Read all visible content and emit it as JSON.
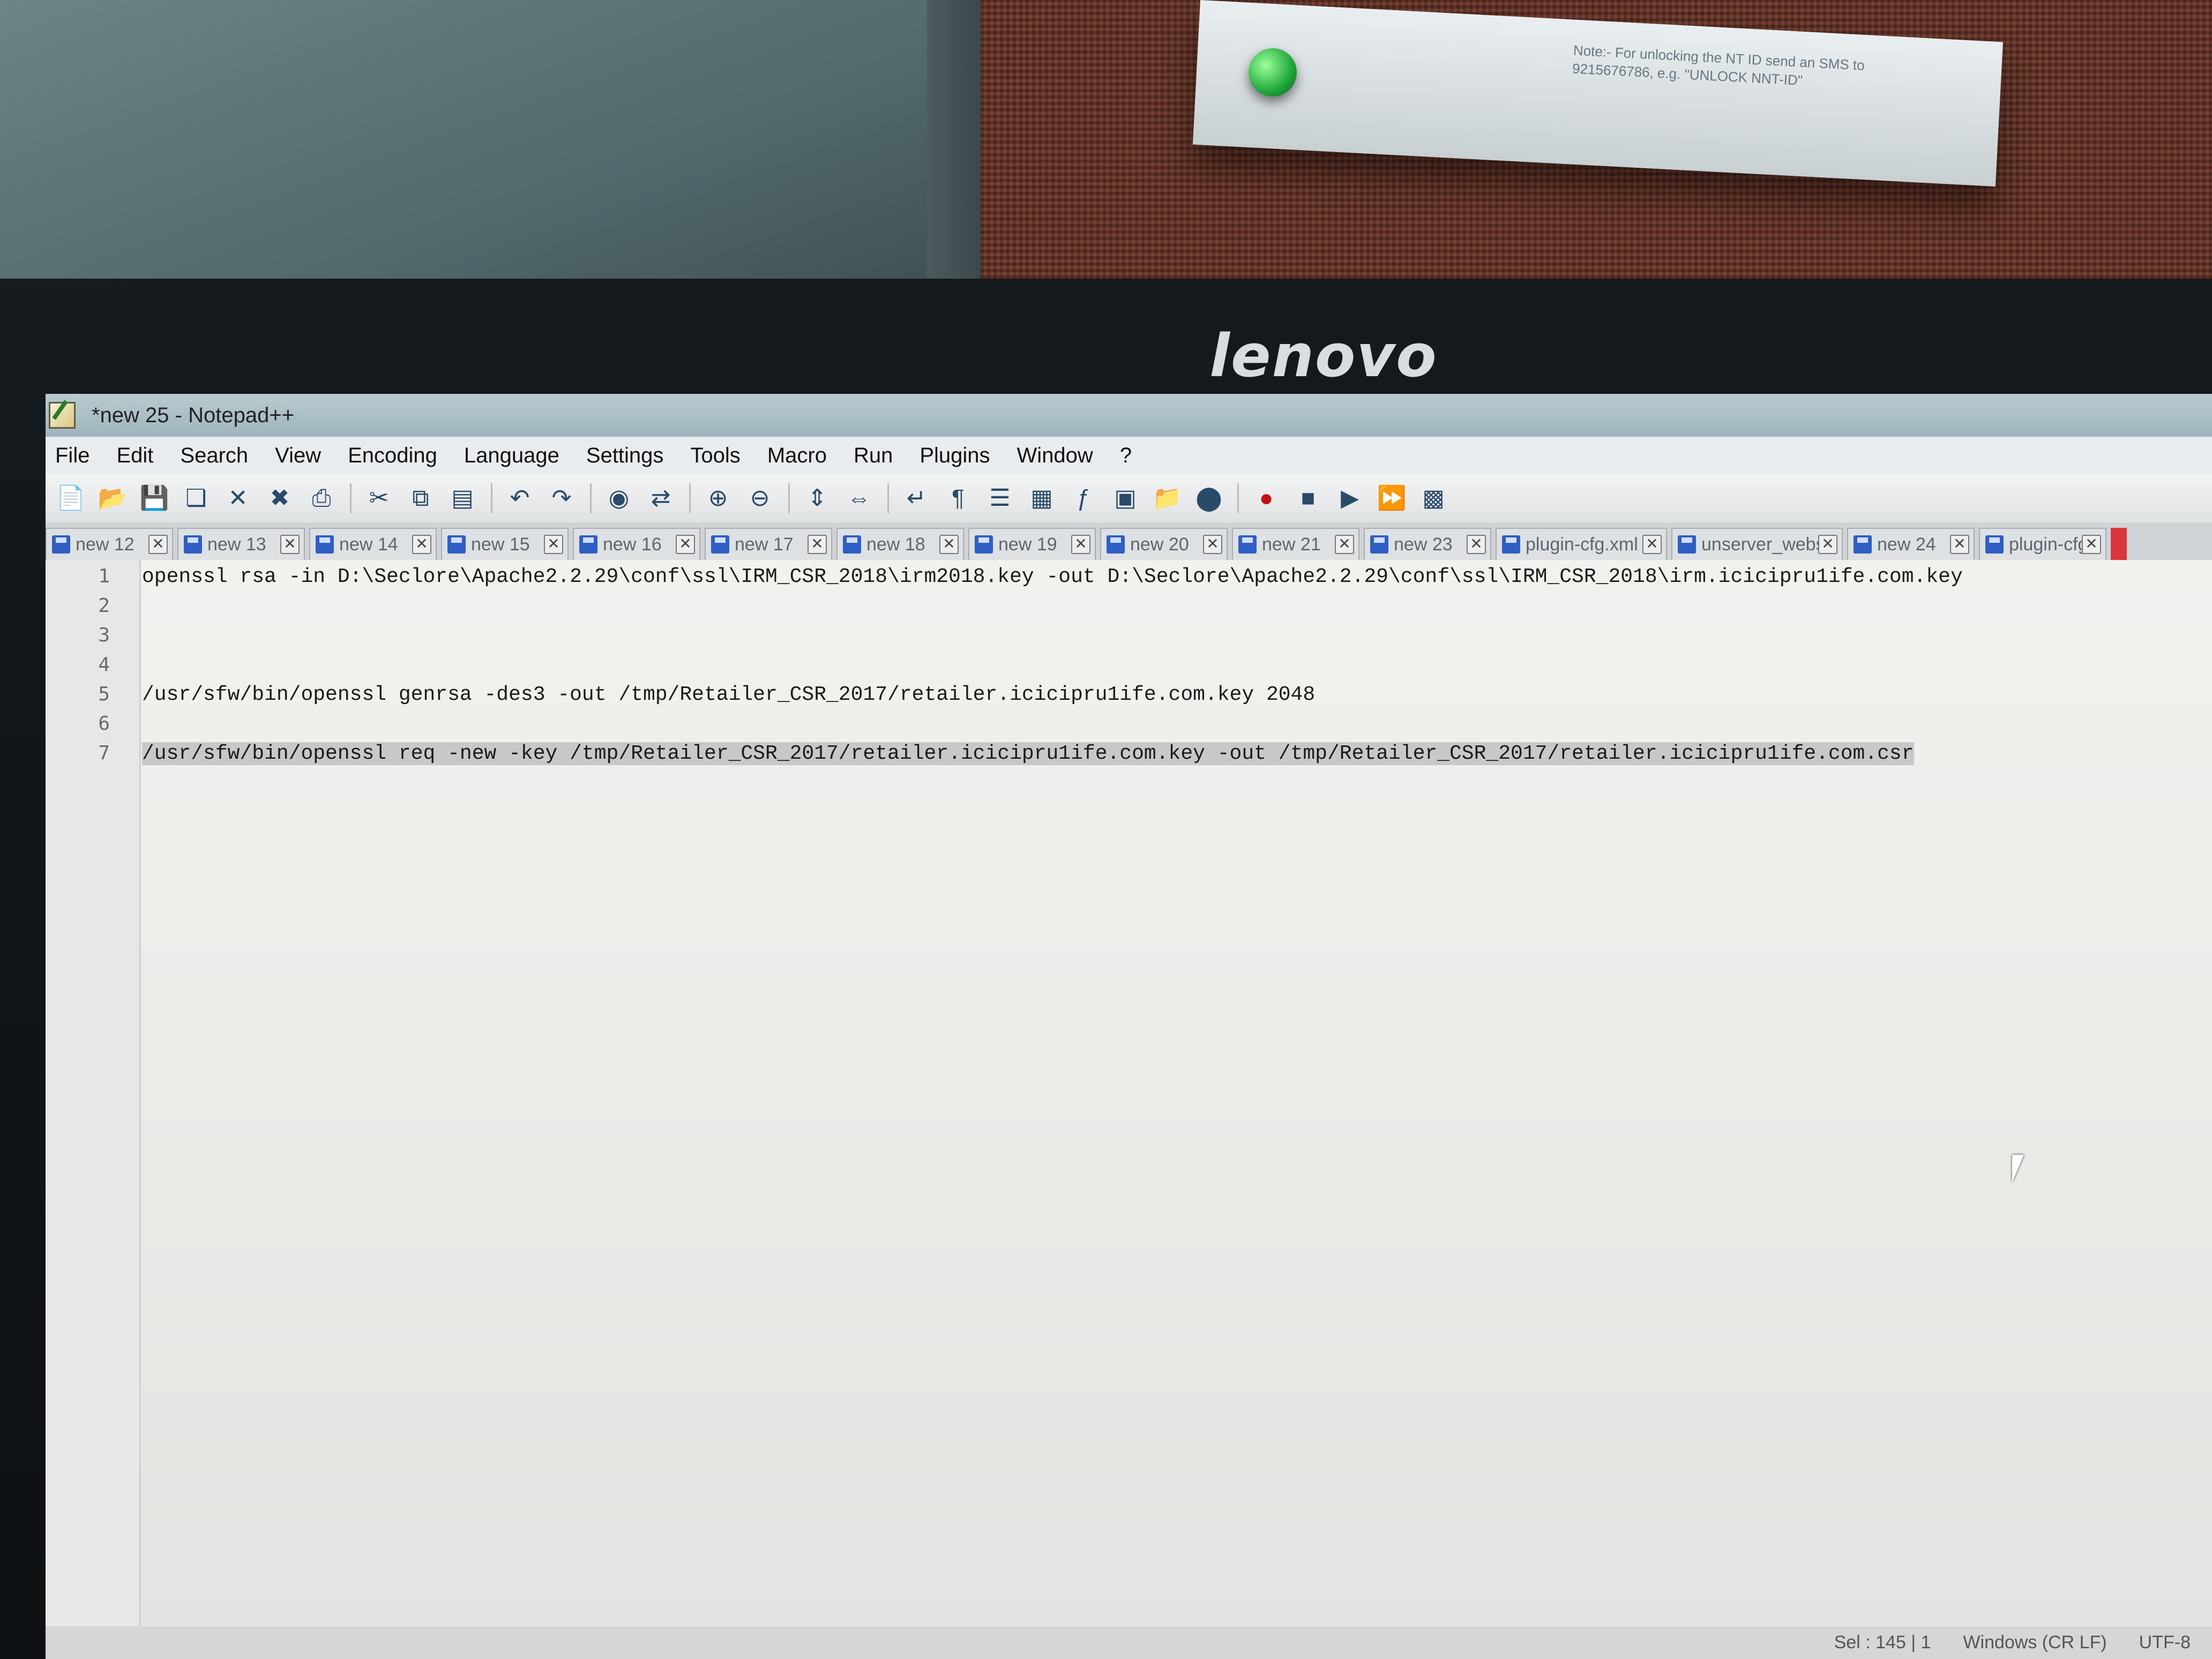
{
  "brand": "lenovo",
  "notice_text": "Note:- For unlocking the NT ID send an SMS to 9215676786, e.g. \"UNLOCK NNT-ID\"",
  "window": {
    "title": "*new 25 - Notepad++"
  },
  "menu": [
    "File",
    "Edit",
    "Search",
    "View",
    "Encoding",
    "Language",
    "Settings",
    "Tools",
    "Macro",
    "Run",
    "Plugins",
    "Window",
    "?"
  ],
  "toolbar_icons": [
    "new-file-icon",
    "open-file-icon",
    "save-icon",
    "save-all-icon",
    "close-icon",
    "close-all-icon",
    "print-icon",
    "cut-icon",
    "copy-icon",
    "paste-icon",
    "undo-icon",
    "redo-icon",
    "find-icon",
    "replace-icon",
    "zoom-in-icon",
    "zoom-out-icon",
    "sync-vertical-icon",
    "sync-horizontal-icon",
    "word-wrap-icon",
    "show-all-chars-icon",
    "indent-guide-icon",
    "doc-map-icon",
    "function-list-icon",
    "udl-icon",
    "folder-workspace-icon",
    "monitor-icon",
    "record-macro-icon",
    "stop-macro-icon",
    "play-macro-icon",
    "run-macro-multiple-icon",
    "save-macro-icon"
  ],
  "tabs": [
    {
      "label": "new 12"
    },
    {
      "label": "new 13"
    },
    {
      "label": "new 14"
    },
    {
      "label": "new 15"
    },
    {
      "label": "new 16"
    },
    {
      "label": "new 17"
    },
    {
      "label": "new 18"
    },
    {
      "label": "new 19"
    },
    {
      "label": "new 20"
    },
    {
      "label": "new 21"
    },
    {
      "label": "new 23"
    },
    {
      "label": "plugin-cfg.xml"
    },
    {
      "label": "unserver_webserver"
    },
    {
      "label": "new 24"
    },
    {
      "label": "plugin-cfg.xml"
    }
  ],
  "editor": {
    "lines": [
      {
        "num": "1",
        "text": "openssl rsa -in D:\\Seclore\\Apache2.2.29\\conf\\ssl\\IRM_CSR_2018\\irm2018.key -out D:\\Seclore\\Apache2.2.29\\conf\\ssl\\IRM_CSR_2018\\irm.icicipru1ife.com.key"
      },
      {
        "num": "2",
        "text": ""
      },
      {
        "num": "3",
        "text": ""
      },
      {
        "num": "4",
        "text": ""
      },
      {
        "num": "5",
        "text": "/usr/sfw/bin/openssl genrsa -des3 -out /tmp/Retailer_CSR_2017/retailer.icicipru1ife.com.key 2048"
      },
      {
        "num": "6",
        "text": ""
      },
      {
        "num": "7",
        "text": "/usr/sfw/bin/openssl req -new -key /tmp/Retailer_CSR_2017/retailer.icicipru1ife.com.key -out /tmp/Retailer_CSR_2017/retailer.icicipru1ife.com.csr"
      }
    ]
  },
  "status": {
    "position": "Sel : 145 | 1",
    "eol": "Windows (CR LF)",
    "encoding": "UTF-8"
  }
}
